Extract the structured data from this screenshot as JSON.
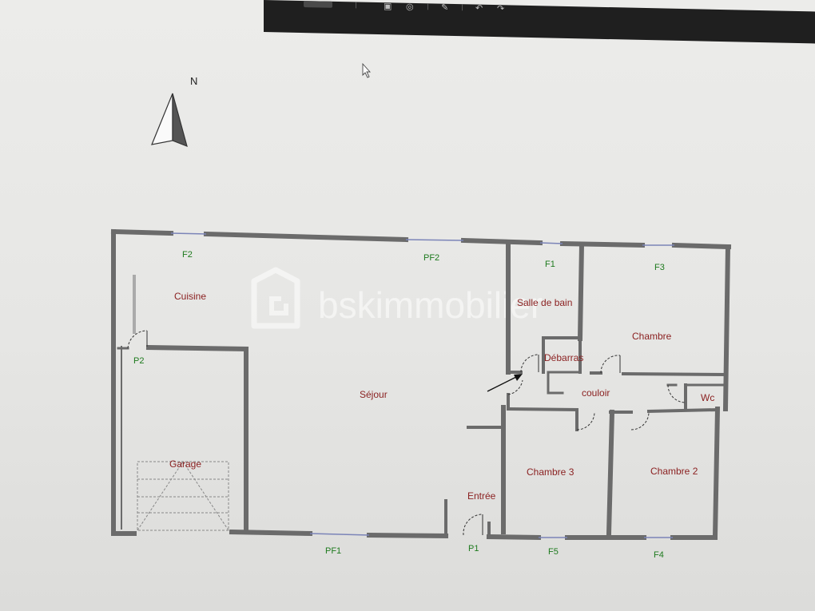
{
  "toolbar": {
    "icons": [
      "save-icon",
      "link-icon",
      "draw-icon",
      "undo-icon",
      "redo-icon"
    ],
    "undo_glyph": "↶",
    "redo_glyph": "↷"
  },
  "plan": {
    "north_label": "N",
    "rooms": {
      "cuisine": "Cuisine",
      "sejour": "Séjour",
      "salle_de_bain": "Salle de bain",
      "chambre": "Chambre",
      "debarras": "Débarras",
      "couloir": "couloir",
      "wc": "Wc",
      "chambre3": "Chambre 3",
      "chambre2": "Chambre 2",
      "garage": "Garage",
      "entree": "Entrée"
    },
    "openings": {
      "f2": "F2",
      "pf2": "PF2",
      "f1": "F1",
      "f3": "F3",
      "p2": "P2",
      "pf1": "PF1",
      "p1": "P1",
      "f5": "F5",
      "f4": "F4"
    },
    "watermark": "bskimmobilier",
    "colors": {
      "wall": "#6b6b6b",
      "room_label": "#8a1f1f",
      "opening_label": "#1d7a1d",
      "window": "#7b84b8"
    }
  }
}
